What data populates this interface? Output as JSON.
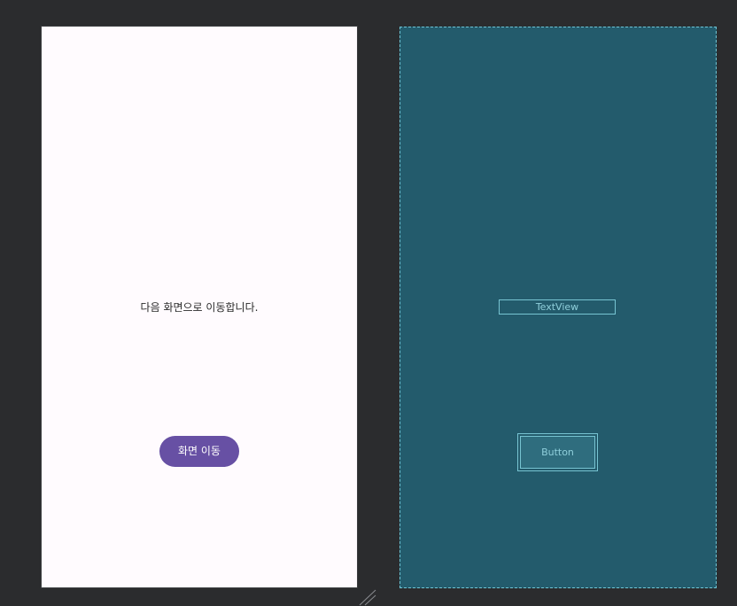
{
  "design": {
    "message_text": "다음 화면으로 이동합니다.",
    "button_label": "화면 이동",
    "button_color": "#6750a4",
    "background_color": "#fffbfe"
  },
  "blueprint": {
    "textview_label": "TextView",
    "button_label": "Button",
    "background_color": "#235b6c",
    "outline_color": "#77c4d2"
  },
  "icons": {
    "resize": "resize-handle-icon"
  }
}
